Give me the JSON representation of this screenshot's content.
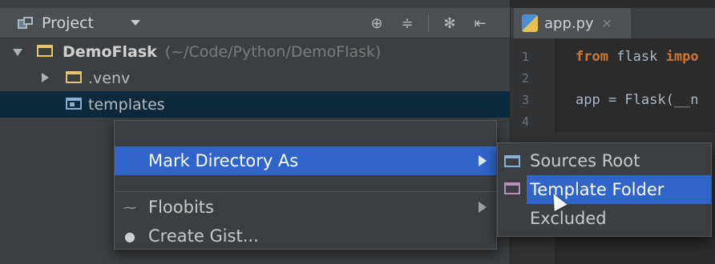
{
  "project_panel": {
    "title": "Project",
    "tree": [
      {
        "name": "DemoFlask",
        "path": "(~/Code/Python/DemoFlask)"
      },
      {
        "name": ".venv"
      },
      {
        "name": "templates"
      }
    ]
  },
  "editor": {
    "tab_label": "app.py",
    "tab_close": "×",
    "line_numbers": [
      "1",
      "2",
      "3",
      "4"
    ],
    "lines": [
      {
        "kw": "from",
        "text": " flask ",
        "kw2": "impo"
      },
      {
        "text": ""
      },
      {
        "text": "app = Flask(__n"
      },
      {
        "text": ""
      }
    ]
  },
  "context_menu": {
    "items": [
      {
        "label": "Mark Directory As",
        "has_submenu": true
      },
      {
        "label": "Floobits",
        "has_submenu": true
      },
      {
        "label": "Create Gist..."
      }
    ]
  },
  "submenu": {
    "items": [
      {
        "label": "Sources Root"
      },
      {
        "label": "Template Folder"
      },
      {
        "label": "Excluded"
      }
    ]
  },
  "colors": {
    "selection": "#2f65ca",
    "tree_selection": "#0d293e",
    "keyword": "#cc7832"
  }
}
